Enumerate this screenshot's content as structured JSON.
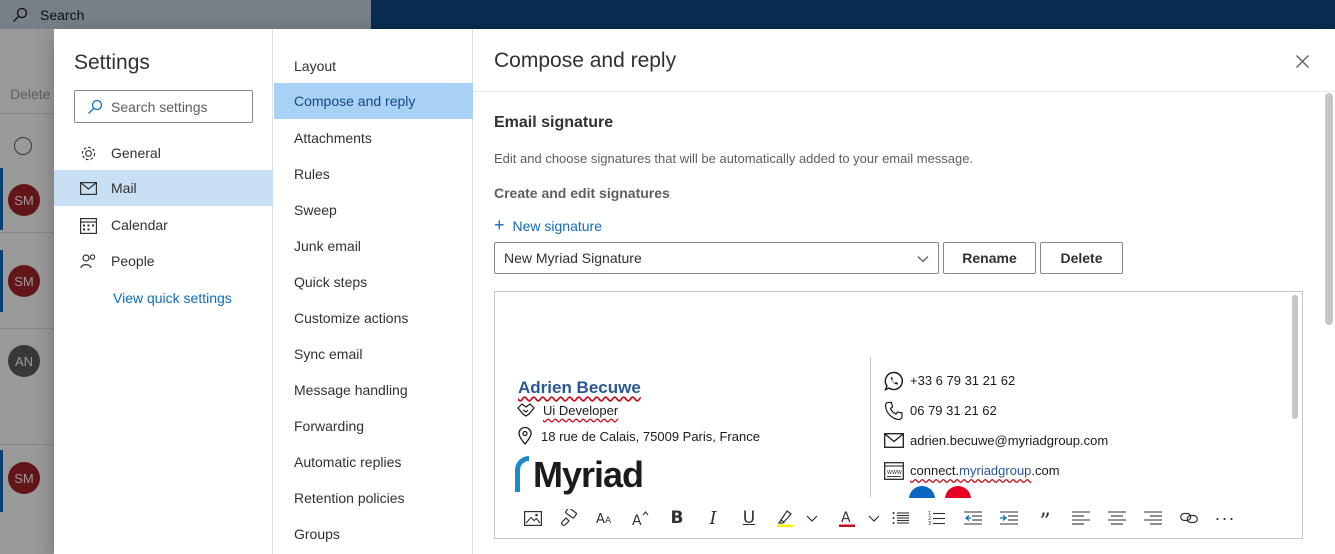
{
  "background": {
    "search_label": "Search",
    "delete_label": "Delete",
    "avatars": [
      "SM",
      "SM",
      "AN",
      "SM"
    ]
  },
  "settings": {
    "title": "Settings",
    "search_placeholder": "Search settings",
    "categories": [
      {
        "label": "General",
        "icon": "gear-icon"
      },
      {
        "label": "Mail",
        "icon": "mail-icon"
      },
      {
        "label": "Calendar",
        "icon": "calendar-icon"
      },
      {
        "label": "People",
        "icon": "people-icon"
      }
    ],
    "selected_category": "Mail",
    "quick_settings_link": "View quick settings"
  },
  "mail_sections": [
    "Layout",
    "Compose and reply",
    "Attachments",
    "Rules",
    "Sweep",
    "Junk email",
    "Quick steps",
    "Customize actions",
    "Sync email",
    "Message handling",
    "Forwarding",
    "Automatic replies",
    "Retention policies",
    "Groups"
  ],
  "selected_section": "Compose and reply",
  "pane": {
    "title": "Compose and reply",
    "section_title": "Email signature",
    "section_description": "Edit and choose signatures that will be automatically added to your email message.",
    "subsection_title": "Create and edit signatures",
    "new_signature_label": "New signature",
    "selected_signature": "New Myriad Signature",
    "rename_label": "Rename",
    "delete_label": "Delete"
  },
  "signature": {
    "name": "Adrien Becuwe",
    "role": "Ui Developer",
    "address": "18 rue de Calais, 75009 Paris, France",
    "logo_text": "Myriad",
    "whatsapp": "+33 6 79 31 21 62",
    "phone": "06 79 31 21 62",
    "email": "adrien.becuwe@myriadgroup.com",
    "website_prefix": "connect.",
    "website_domain": "myriadgroup",
    "website_suffix": ".com"
  },
  "toolbar_tools": [
    "insert-picture",
    "format-painter",
    "font-size",
    "grow-font",
    "bold",
    "italic",
    "underline",
    "highlight",
    "font-color",
    "bullets",
    "numbering",
    "decrease-indent",
    "increase-indent",
    "quote",
    "align-left",
    "align-center",
    "align-right",
    "link",
    "more"
  ],
  "colors": {
    "topbar": "#0f4a87",
    "accent": "#0f6cbd",
    "selected_category": "#c7e0f4",
    "selected_section": "#a9d1f5",
    "signature_name": "#2b5797",
    "logo_arc": "#1f8ac9",
    "highlight": "#fff100",
    "font_color": "#c50f1f"
  }
}
